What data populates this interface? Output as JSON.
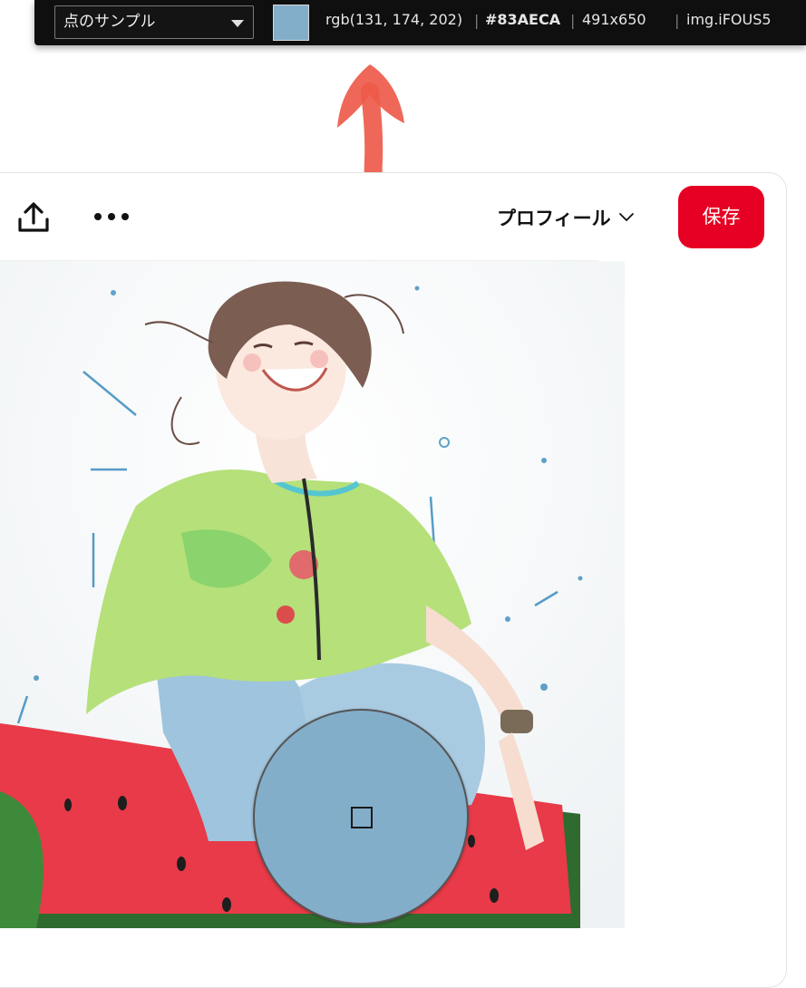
{
  "picker": {
    "mode_label": "点のサンプル",
    "swatch_color": "#83AECA",
    "rgb_text": "rgb(131, 174, 202)",
    "hex_text": "#83AECA",
    "size_text": "491x650",
    "element_text": "img.iFOUS5",
    "separator": "|"
  },
  "pin_header": {
    "share_icon": "share-upload-icon",
    "more_icon": "ellipsis-icon",
    "profile_label": "プロフィール",
    "save_label": "保存",
    "save_color": "#E60023"
  },
  "pin": {
    "image_description_icon": "watercolor-illustration",
    "loupe_color": "#83AECA"
  },
  "annotation": {
    "arrow_color": "#EE5A4A"
  }
}
